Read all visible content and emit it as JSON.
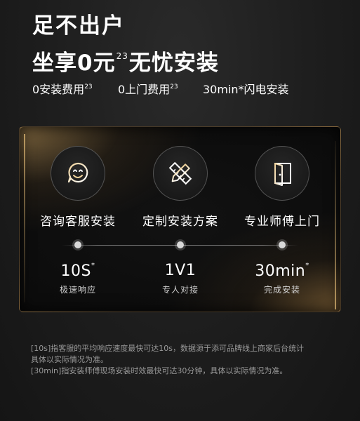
{
  "headline": {
    "line1": "足不出户",
    "line2_pre": "坐享0元",
    "line2_sup": "23",
    "line2_post": "无忧安装"
  },
  "features": [
    {
      "label": "0安装费用",
      "sup": "23"
    },
    {
      "label": "0上门费用",
      "sup": "23"
    },
    {
      "label": "30min*闪电安装",
      "sup": ""
    }
  ],
  "services": [
    {
      "icon": "phone-smile-icon",
      "label": "咨询客服安装",
      "stat": "10S",
      "stat_sup": "*",
      "sub": "极速响应"
    },
    {
      "icon": "pencil-ruler-icon",
      "label": "定制安装方案",
      "stat": "1V1",
      "stat_sup": "",
      "sub": "专人对接"
    },
    {
      "icon": "door-icon",
      "label": "专业师傅上门",
      "stat": "30min",
      "stat_sup": "*",
      "sub": "完成安装"
    }
  ],
  "notes": {
    "line1": "[10s]指客服的平均响应速度最快可达10s，数据源于添可品牌线上商家后台统计",
    "line2": "具体以实际情况为准。",
    "line3": "[30min]指安装师傅现场安装时效最快可达30分钟，具体以实际情况为准。"
  },
  "colors": {
    "accent_gold": "#d6aa64",
    "background": "#1d1d1d"
  }
}
